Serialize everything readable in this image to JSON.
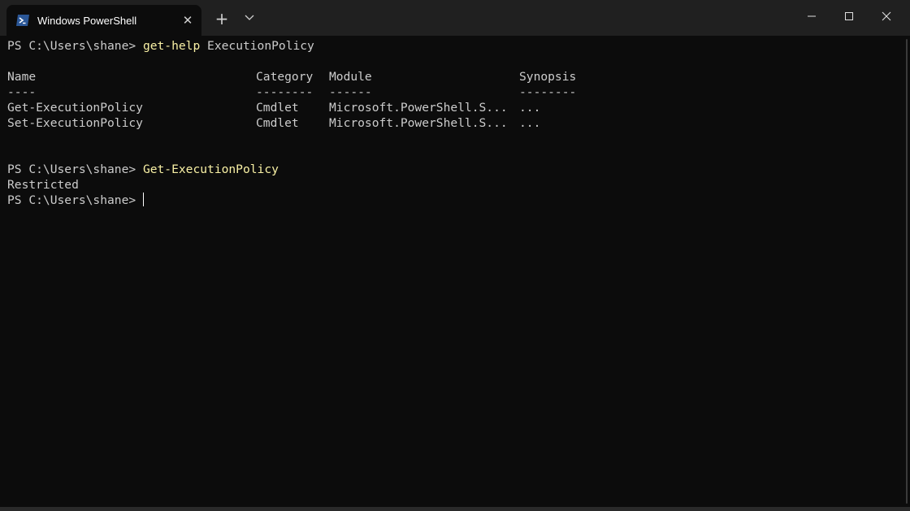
{
  "window": {
    "tab_title": "Windows PowerShell",
    "tab_icon": "powershell-icon",
    "close_tab_icon": "close-icon",
    "new_tab_icon": "plus-icon",
    "dropdown_icon": "chevron-down-icon",
    "controls": [
      "minimize-icon",
      "maximize-icon",
      "close-icon"
    ]
  },
  "colors": {
    "background": "#0c0c0c",
    "titlebar": "#202020",
    "text": "#cccccc",
    "command": "#f9f1a5",
    "tab_icon_bg": "#2b5797"
  },
  "terminal": {
    "prompt": "PS C:\\Users\\shane>",
    "command1_name": "get-help",
    "command1_arg": "ExecutionPolicy",
    "table": {
      "headers": [
        "Name",
        "Category",
        "Module",
        "Synopsis"
      ],
      "underlines": [
        "----",
        "--------",
        "------",
        "--------"
      ],
      "rows": [
        [
          "Get-ExecutionPolicy",
          "Cmdlet",
          "Microsoft.PowerShell.S...",
          "..."
        ],
        [
          "Set-ExecutionPolicy",
          "Cmdlet",
          "Microsoft.PowerShell.S...",
          "..."
        ]
      ]
    },
    "command2": "Get-ExecutionPolicy",
    "output": "Restricted"
  }
}
